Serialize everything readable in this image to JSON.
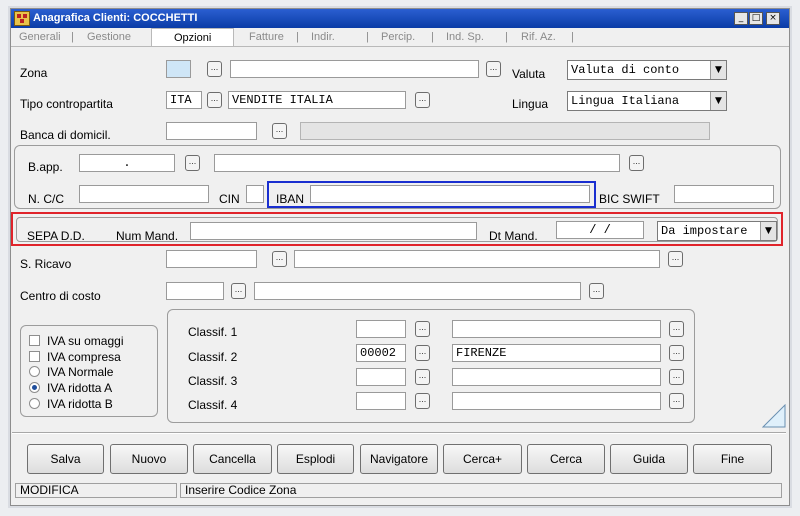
{
  "window": {
    "title": "Anagrafica Clienti: COCCHETTI"
  },
  "window_buttons": {
    "minimize": "_",
    "maximize": "□",
    "close": "×"
  },
  "tabs": [
    {
      "label": "Generali"
    },
    {
      "label": "Gestione"
    },
    {
      "label": "Opzioni"
    },
    {
      "label": "Fatture"
    },
    {
      "label": "Indir."
    },
    {
      "label": "Percip."
    },
    {
      "label": "Ind. Sp."
    },
    {
      "label": "Rif. Az."
    }
  ],
  "tab_separator": "|",
  "lookup_label": "...",
  "form": {
    "zona": {
      "label": "Zona",
      "code": "",
      "description": ""
    },
    "valuta": {
      "label": "Valuta",
      "value": "Valuta di conto"
    },
    "tipo_contropartita": {
      "label": "Tipo contropartita",
      "code": "ITA",
      "description": "VENDITE ITALIA"
    },
    "lingua": {
      "label": "Lingua",
      "value": "Lingua Italiana"
    },
    "banca": {
      "label": "Banca di domicil.",
      "code": "",
      "description": ""
    },
    "bapp": {
      "label": "B.app.",
      "code": ".",
      "description": ""
    },
    "ncc": {
      "label": "N. C/C",
      "value": ""
    },
    "cin": {
      "label": "CIN",
      "value": ""
    },
    "iban": {
      "label": "IBAN",
      "value": ""
    },
    "bic": {
      "label": "BIC SWIFT",
      "value": ""
    },
    "sepa": {
      "label": "SEPA D.D.",
      "num_mand_label": "Num Mand.",
      "num_mand": "",
      "dt_mand_label": "Dt Mand.",
      "dt_mand": "/ /",
      "status": "Da impostare"
    },
    "s_ricavo": {
      "label": "S. Ricavo",
      "code": "",
      "description": ""
    },
    "centro_costo": {
      "label": "Centro di costo",
      "code": "",
      "description": ""
    },
    "iva": {
      "checkboxes": [
        {
          "label": "IVA su omaggi",
          "checked": false
        },
        {
          "label": "IVA compresa",
          "checked": false
        }
      ],
      "radios": [
        {
          "label": "IVA Normale",
          "selected": false
        },
        {
          "label": "IVA ridotta A",
          "selected": true
        },
        {
          "label": "IVA ridotta B",
          "selected": false
        }
      ]
    },
    "classif": [
      {
        "label": "Classif. 1",
        "code": "",
        "description": ""
      },
      {
        "label": "Classif. 2",
        "code": "00002",
        "description": "FIRENZE"
      },
      {
        "label": "Classif. 3",
        "code": "",
        "description": ""
      },
      {
        "label": "Classif. 4",
        "code": "",
        "description": ""
      }
    ]
  },
  "buttons": {
    "salva": "Salva",
    "nuovo": "Nuovo",
    "cancella": "Cancella",
    "esplodi": "Esplodi",
    "navigatore": "Navigatore",
    "cerca_plus": "Cerca+",
    "cerca": "Cerca",
    "guida": "Guida",
    "fine": "Fine"
  },
  "status": {
    "mode": "MODIFICA",
    "message": "Inserire Codice Zona"
  },
  "colors": {
    "iban_highlight": "#1a2fd0",
    "sepa_highlight": "#e0242b",
    "title_bar": "#1a4fc0"
  }
}
